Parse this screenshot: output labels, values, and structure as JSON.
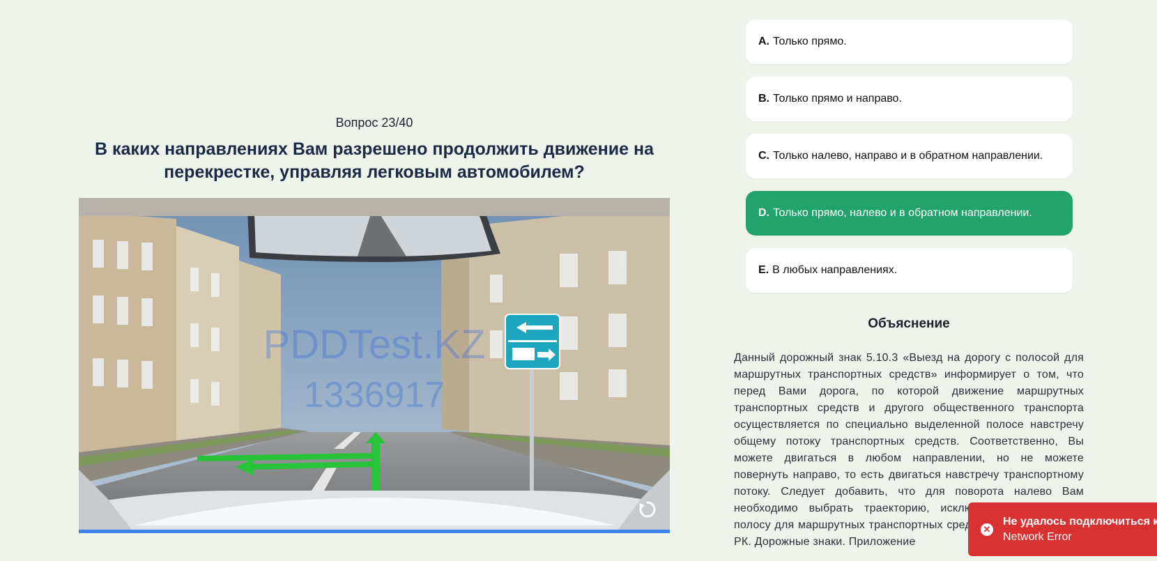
{
  "question": {
    "number_label": "Вопрос 23/40",
    "title": "В каких направлениях Вам разрешено продолжить движение на перекрестке, управляя легковым автомобилем?"
  },
  "media": {
    "watermark_line1": "PDDTest.KZ",
    "watermark_line2": "1336917",
    "replay_icon": "replay-icon",
    "progress": 1.0
  },
  "answers": [
    {
      "letter": "A.",
      "text": "Только прямо.",
      "selected": false
    },
    {
      "letter": "B.",
      "text": "Только прямо и направо.",
      "selected": false
    },
    {
      "letter": "C.",
      "text": "Только налево, направо и в обратном направлении.",
      "selected": false
    },
    {
      "letter": "D.",
      "text": "Только прямо, налево и в обратном направлении.",
      "selected": true
    },
    {
      "letter": "E.",
      "text": "В любых направлениях.",
      "selected": false
    }
  ],
  "explanation": {
    "title": "Объяснение",
    "text": "Данный дорожный знак 5.10.3 «Выезд на дорогу с полосой для маршрутных транспортных средств» информирует о том, что перед Вами дорога, по которой движение маршрутных транспортных средств и другого общественного транспорта осуществляется по специально выделенной полосе навстречу общему потоку транспортных средств. Соответственно, Вы можете двигаться в любом направлении, но не можете повернуть направо, то есть двигаться навстречу транспортному потоку. Следует добавить, что для поворота налево Вам необходимо выбрать траекторию, исключающую выезд на полосу для маршрутных транспортных средств. П. 9.7, 126, ПДД РК. Дорожные знаки. Приложение"
  },
  "toast": {
    "title": "Не удалось подключиться к серверу",
    "message": "Network Error",
    "icon": "error-icon",
    "color": "#d93131"
  },
  "colors": {
    "background": "#eef4ec",
    "selected_answer": "#22a36b",
    "title_text": "#1a2a44"
  }
}
